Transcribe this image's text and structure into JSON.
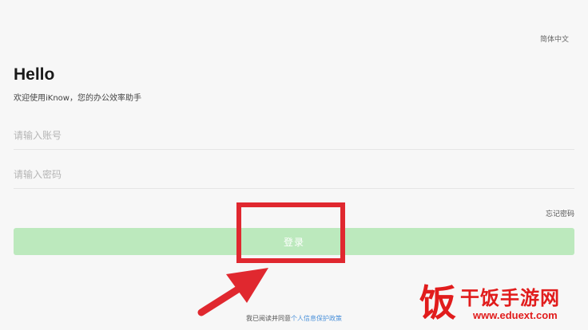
{
  "header": {
    "language": "简体中文"
  },
  "greeting": {
    "title": "Hello",
    "subtitle": "欢迎使用iKnow，您的办公效率助手"
  },
  "form": {
    "username_placeholder": "请输入账号",
    "password_placeholder": "请输入密码",
    "forgot_password": "忘记密码",
    "login_button": "登录"
  },
  "footer": {
    "agreement_prefix": "我已阅读并同意",
    "agreement_link": "个人信息保护政策"
  },
  "annotation": {
    "color": "#e0282f"
  },
  "watermark": {
    "logo_char": "饭",
    "name": "干饭手游网",
    "url": "www.eduext.com",
    "color": "#e11c1c"
  },
  "colors": {
    "login_button_bg": "#bce9bd",
    "link": "#4a90d9",
    "background": "#f7f7f7"
  }
}
